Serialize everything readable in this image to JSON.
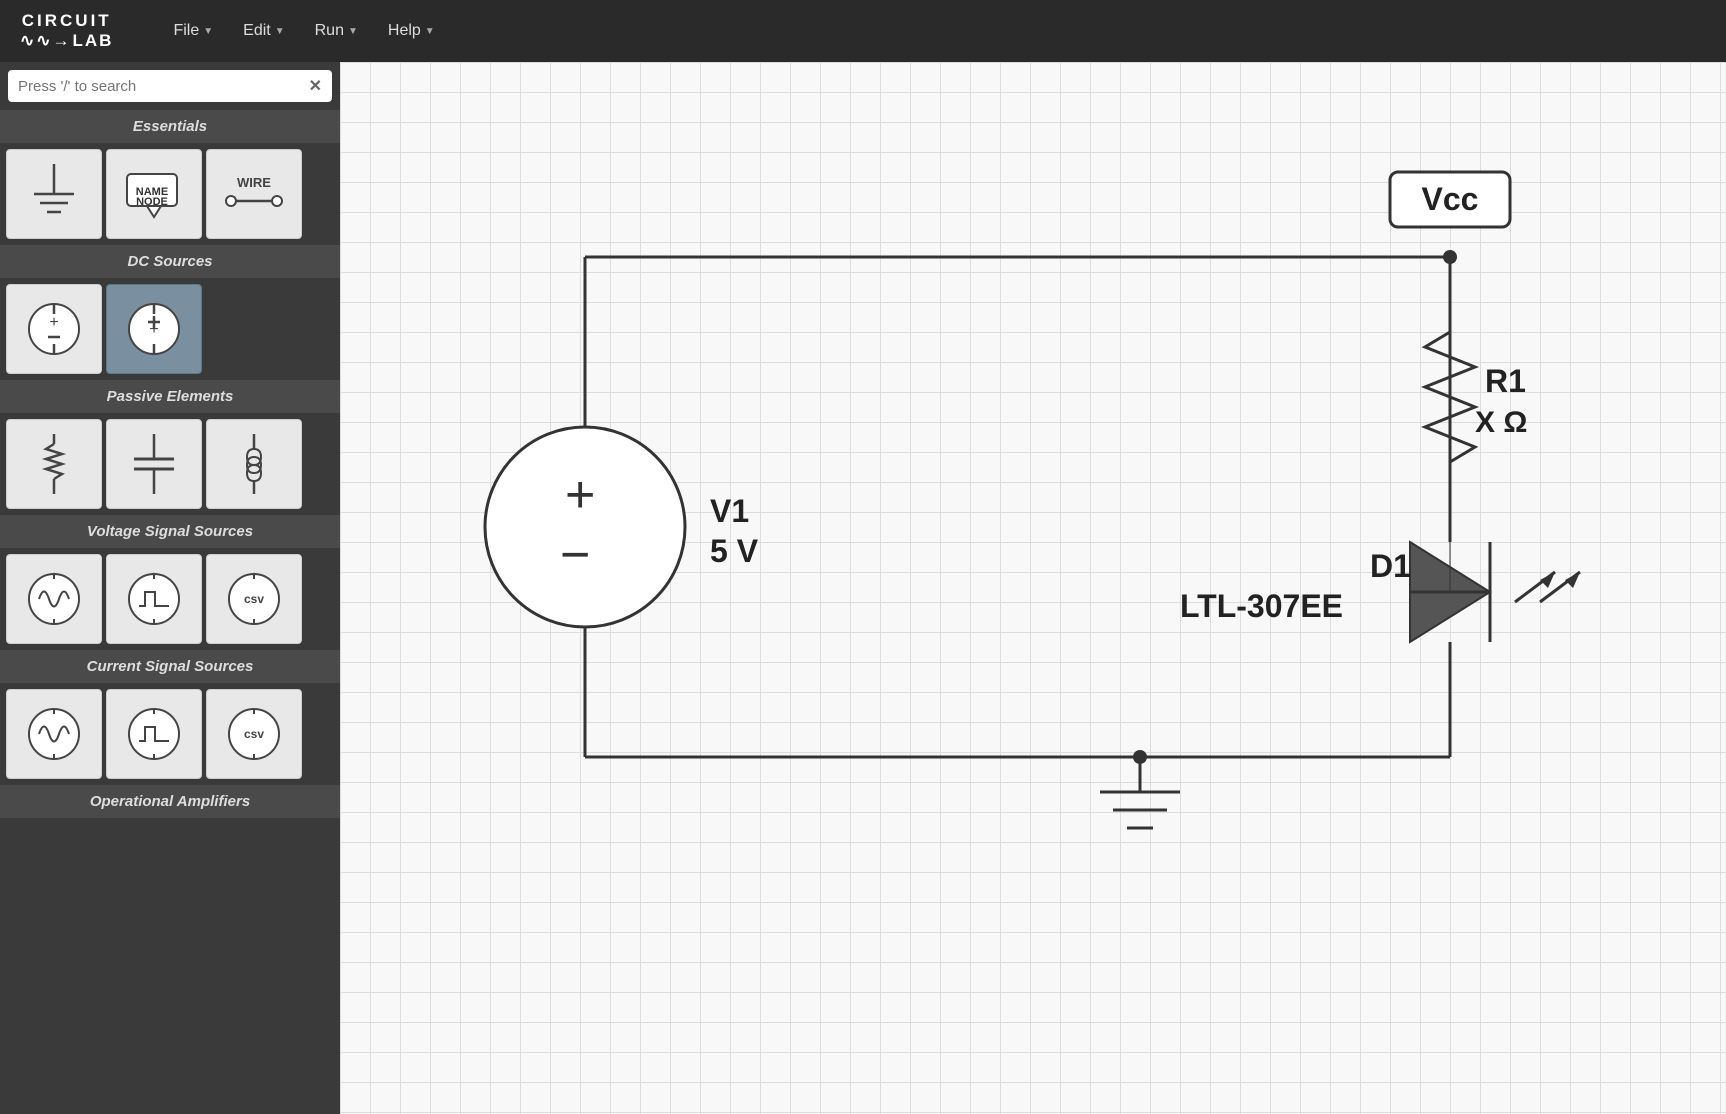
{
  "navbar": {
    "logo_top": "CIRCUIT",
    "logo_bottom": "LAB",
    "menu_items": [
      {
        "label": "File",
        "has_arrow": true
      },
      {
        "label": "Edit",
        "has_arrow": true
      },
      {
        "label": "Run",
        "has_arrow": true
      },
      {
        "label": "Help",
        "has_arrow": true
      }
    ]
  },
  "sidebar": {
    "search_placeholder": "Press '/' to search",
    "sections": [
      {
        "title": "Essentials",
        "items": [
          "ground",
          "name-node",
          "wire"
        ]
      },
      {
        "title": "DC Sources",
        "items": [
          "voltage-dc",
          "current-dc"
        ]
      },
      {
        "title": "Passive Elements",
        "items": [
          "resistor",
          "capacitor",
          "inductor"
        ]
      },
      {
        "title": "Voltage Signal Sources",
        "items": [
          "voltage-ac",
          "voltage-pulse",
          "voltage-csv"
        ]
      },
      {
        "title": "Current Signal Sources",
        "items": [
          "current-ac",
          "current-pulse",
          "current-csv"
        ]
      },
      {
        "title": "Operational Amplifiers",
        "items": []
      }
    ]
  },
  "circuit": {
    "vcc_label": "Vcc",
    "r1_label": "R1",
    "r1_value": "X Ω",
    "v1_label": "V1",
    "v1_value": "5 V",
    "d1_label": "D1",
    "d1_part": "LTL-307EE"
  }
}
